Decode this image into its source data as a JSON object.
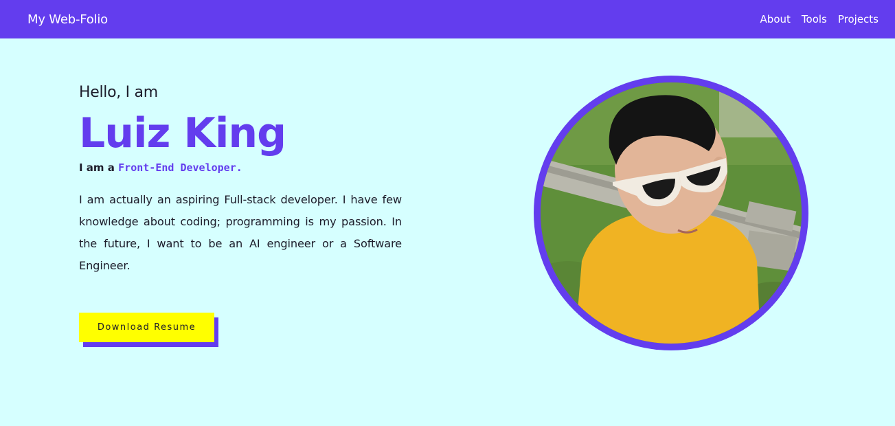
{
  "nav": {
    "brand": "My Web-Folio",
    "links": [
      "About",
      "Tools",
      "Projects"
    ]
  },
  "hero": {
    "greeting": "Hello, I am",
    "name": "Luiz King",
    "role_prefix": "I am a",
    "role_title": "Front-End Developer.",
    "bio": "I am actually an aspiring Full-stack developer. I have few knowledge about coding; programming is my passion. In the future, I want to be an AI engineer or a Software Engineer.",
    "cta_label": "Download Resume"
  },
  "profile_photo": {
    "subject": "portrait photo"
  },
  "colors": {
    "accent": "#633dee",
    "background": "#d6ffff",
    "button": "#ffff00",
    "text": "#1d1d2b"
  }
}
